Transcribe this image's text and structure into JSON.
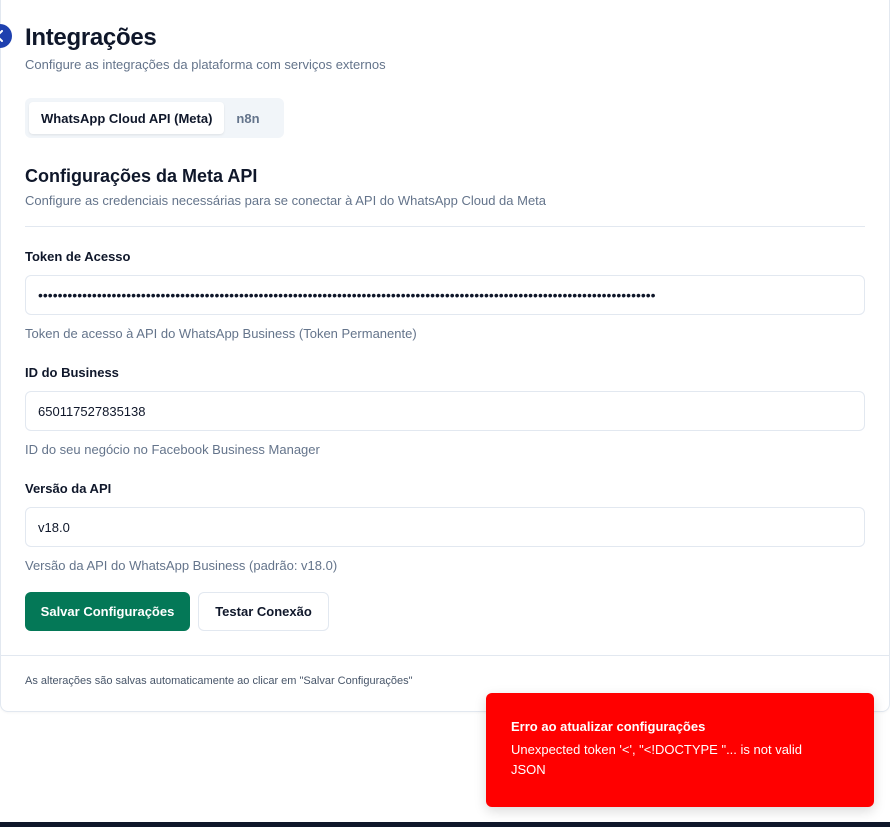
{
  "header": {
    "title": "Integrações",
    "subtitle": "Configure as integrações da plataforma com serviços externos"
  },
  "tabs": [
    {
      "label": "WhatsApp Cloud API (Meta)",
      "active": true
    },
    {
      "label": "n8n",
      "active": false
    }
  ],
  "section": {
    "title": "Configurações da Meta API",
    "description": "Configure as credenciais necessárias para se conectar à API do WhatsApp Cloud da Meta"
  },
  "fields": {
    "token": {
      "label": "Token de Acesso",
      "value": "••••••••••••••••••••••••••••••••••••••••••••••••••••••••••••••••••••••••••••••••••••••••••••••••••••••••••••••••••••••••••••••",
      "help": "Token de acesso à API do WhatsApp Business (Token Permanente)"
    },
    "business_id": {
      "label": "ID do Business",
      "value": "650117527835138",
      "help": "ID do seu negócio no Facebook Business Manager"
    },
    "api_version": {
      "label": "Versão da API",
      "value": "v18.0",
      "help": "Versão da API do WhatsApp Business (padrão: v18.0)"
    }
  },
  "actions": {
    "save_label": "Salvar Configurações",
    "test_label": "Testar Conexão"
  },
  "footer": {
    "note": "As alterações são salvas automaticamente ao clicar em \"Salvar Configurações\""
  },
  "toast": {
    "title": "Erro ao atualizar configurações",
    "message": "Unexpected token '<', \"<!DOCTYPE \"... is not valid JSON"
  },
  "colors": {
    "primary": "#047857",
    "error": "#ff0000",
    "collapse_button": "#1e40af",
    "muted_text": "#64748b"
  }
}
